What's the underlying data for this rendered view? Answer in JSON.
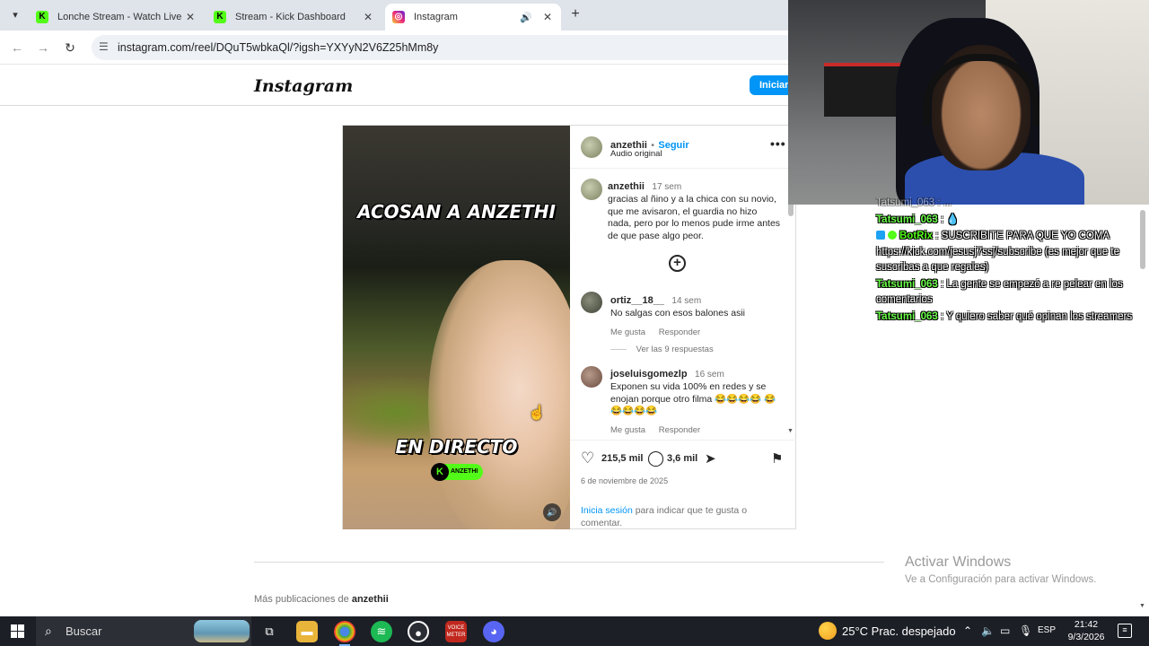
{
  "browser": {
    "tabs": [
      {
        "title": "Lonche Stream - Watch Live on",
        "favicon": "kick-icon"
      },
      {
        "title": "Stream - Kick Dashboard",
        "favicon": "kick-icon"
      },
      {
        "title": "Instagram",
        "favicon": "instagram-icon",
        "active": true
      }
    ],
    "url": "instagram.com/reel/DQuT5wbkaQl/?igsh=YXYyN2V6Z25hMm8y"
  },
  "instagram": {
    "logo": "Instagram",
    "login_button": "Iniciar",
    "post": {
      "video_caption_top": "ACOSAN A ANZETHI",
      "video_caption_bottom": "EN DIRECTO",
      "kick_badge": "ANZETHI",
      "author": "anzethii",
      "follow": "Seguir",
      "separator": "•",
      "audio": "Audio original",
      "caption": {
        "user": "anzethii",
        "time": "17 sem",
        "text": "gracias al ñino y a la chica con su novio, que me avisaron, el guardia no hizo nada, pero por lo menos pude irme antes de que pase algo peor."
      },
      "comments": [
        {
          "user": "ortiz__18__",
          "time": "14 sem",
          "text": "No salgas con esos balones asii",
          "like": "Me gusta",
          "reply": "Responder",
          "view_replies": "Ver las 9 respuestas"
        },
        {
          "user": "joseluisgomezlp",
          "time": "16 sem",
          "text": "Exponen su vida 100% en redes y se enojan porque otro filma 😂😂😂😂 😂😂😂😂😂",
          "like": "Me gusta",
          "reply": "Responder"
        }
      ],
      "likes": "215,5 mil",
      "comments_count": "3,6 mil",
      "date": "6 de noviembre de 2025",
      "login_prompt_link": "Inicia sesión",
      "login_prompt_rest": " para indicar que te gusta o comentar."
    },
    "more_posts_prefix": "Más publicaciones de ",
    "more_posts_user": "anzethii"
  },
  "chat": {
    "faded_line": "Tatsumi_063 : ...",
    "lines": [
      {
        "user": "Tatsumi_063",
        "sep": " : ",
        "text": "💧"
      },
      {
        "user": "BotRix",
        "sep": " : ",
        "text": "SUSCRIBITE PARA QUE YO COMA https://kick.com/jesusj7ssj/subscribe (es mejor que te suscribas a que regales)",
        "badges": true
      },
      {
        "user": "Tatsumi_063",
        "sep": " : ",
        "text": "La gente se empezó a re pelear en los comentarios"
      },
      {
        "user": "Tatsumi_063",
        "sep": " : ",
        "text": "Y quiero saber qué opinan los streamers"
      }
    ]
  },
  "watermark": {
    "title": "Activar Windows",
    "subtitle": "Ve a Configuración para activar Windows."
  },
  "taskbar": {
    "search": "Buscar",
    "weather": "25°C  Prac. despejado",
    "lang": "ESP",
    "time": "21:42",
    "date": "9/3/2026"
  }
}
